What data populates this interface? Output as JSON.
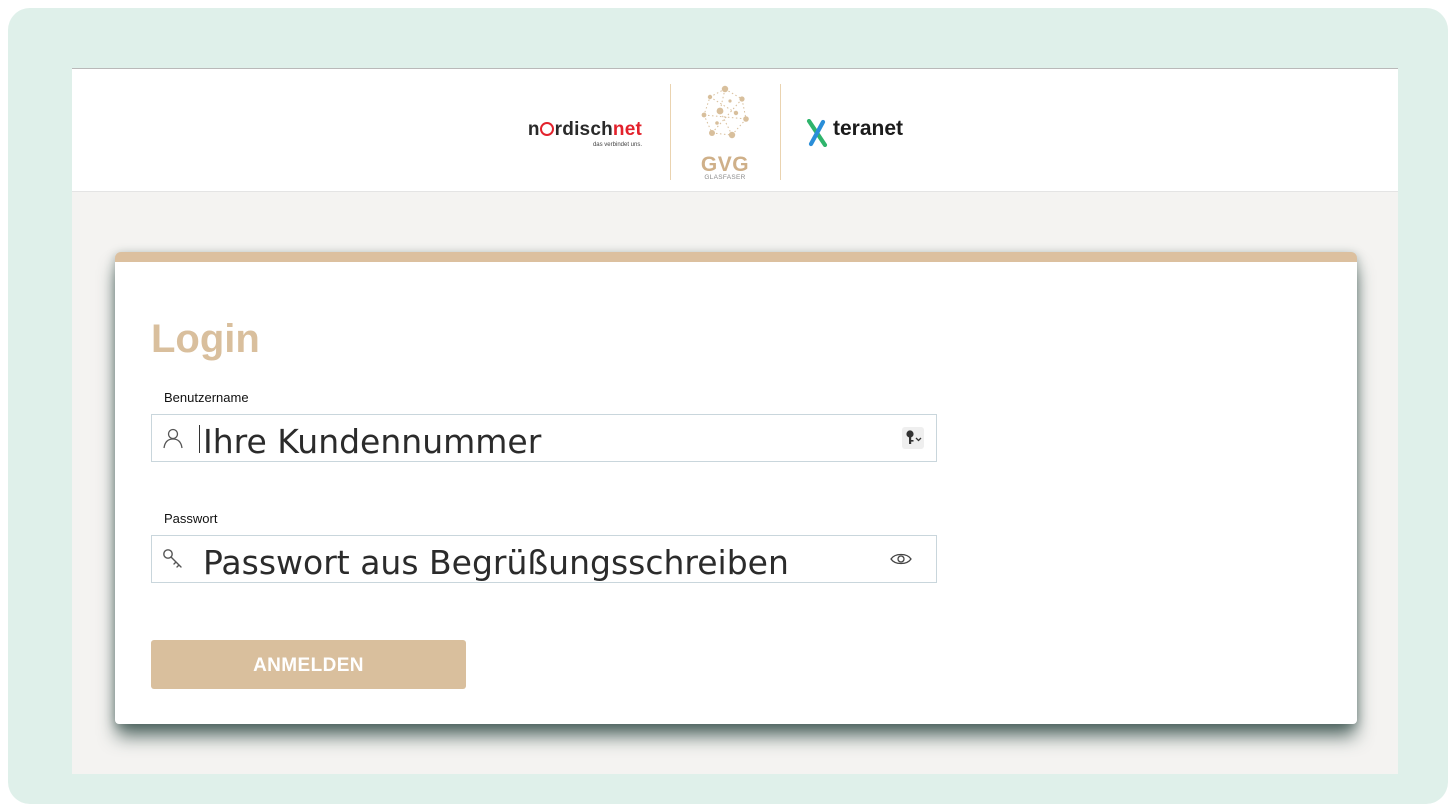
{
  "header": {
    "logos": {
      "nordischnet": {
        "word_a": "n",
        "word_b": "rdisch",
        "word_c": "net",
        "tagline": "das verbindet uns."
      },
      "gvg": {
        "name": "GVG",
        "subtitle": "GLASFASER"
      },
      "teranet": {
        "name": "teranet"
      }
    }
  },
  "login": {
    "title": "Login",
    "username": {
      "label": "Benutzername",
      "value": "Ihre Kundennummer",
      "icon": "user-icon",
      "action_icon": "key-icon"
    },
    "password": {
      "label": "Passwort",
      "value": "Passwort aus Begrüßungsschreiben",
      "icon": "key-icon",
      "action_icon": "eye-icon"
    },
    "submit_label": "ANMELDEN"
  },
  "colors": {
    "accent": "#d9bf9d",
    "frame": "#dff0ea",
    "brand_red": "#e3222c",
    "teranet_green": "#2fb46c",
    "teranet_blue": "#2a8ed8"
  }
}
